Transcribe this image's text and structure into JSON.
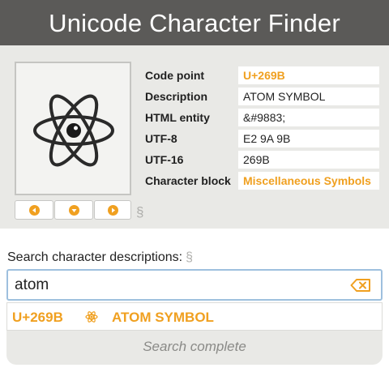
{
  "app": {
    "title": "Unicode Character Finder"
  },
  "character": {
    "glyph_icon": "atom-symbol",
    "properties": [
      {
        "label": "Code point",
        "value": "U+269B",
        "is_link": true
      },
      {
        "label": "Description",
        "value": "ATOM SYMBOL",
        "is_link": false
      },
      {
        "label": "HTML entity",
        "value": "&#9883;",
        "is_link": false
      },
      {
        "label": "UTF-8",
        "value": "E2 9A 9B",
        "is_link": false
      },
      {
        "label": "UTF-16",
        "value": "269B",
        "is_link": false
      },
      {
        "label": "Character block",
        "value": "Miscellaneous Symbols",
        "is_link": true
      }
    ],
    "permalink_symbol": "§"
  },
  "navigation": {
    "prev_icon": "chevron-left-icon",
    "down_icon": "chevron-down-icon",
    "next_icon": "chevron-right-icon"
  },
  "search": {
    "label": "Search character descriptions:",
    "label_link": "§",
    "value": "atom",
    "clear_icon": "backspace-icon"
  },
  "results": {
    "items": [
      {
        "code": "U+269B",
        "glyph": "⚛",
        "name": "ATOM SYMBOL"
      }
    ],
    "status": "Search complete"
  },
  "colors": {
    "accent": "#f0a020",
    "titlebar": "#5b5a58",
    "panel": "#e9e9e6",
    "input_border": "#9ec0de"
  }
}
